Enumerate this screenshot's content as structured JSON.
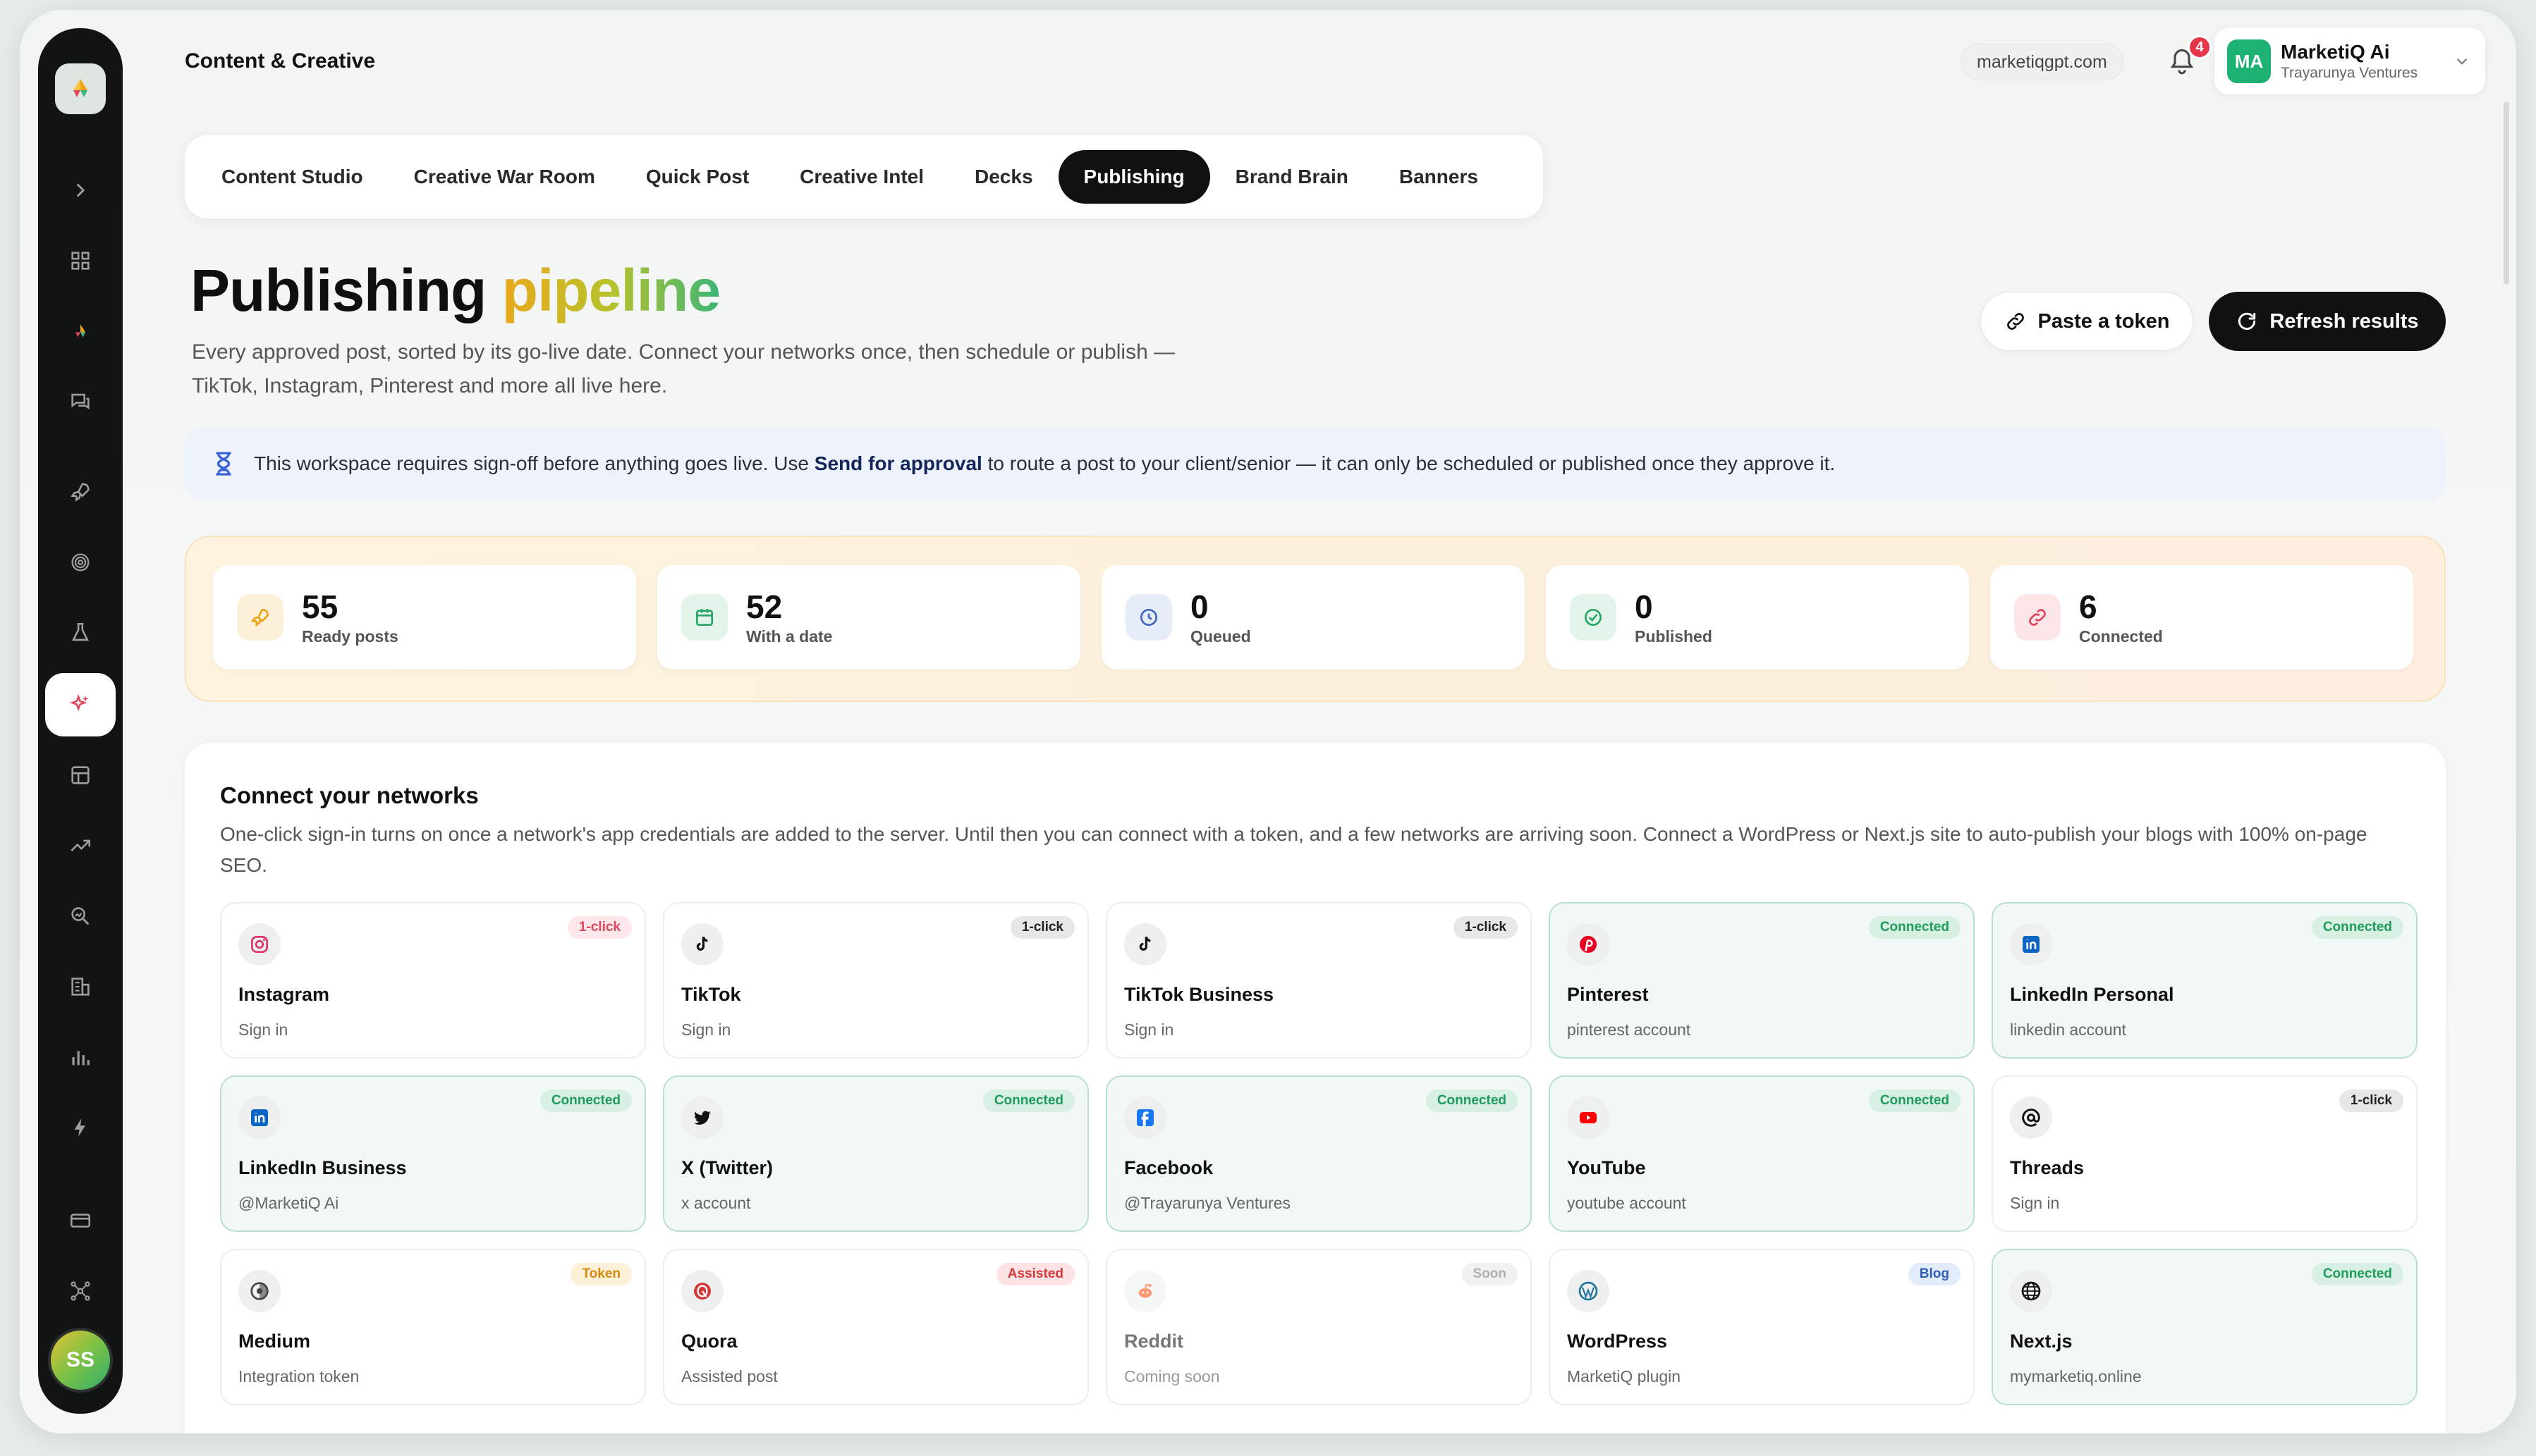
{
  "header": {
    "breadcrumb": "Content & Creative",
    "domain": "marketiqgpt.com",
    "notification_count": "4",
    "user": {
      "initials": "MA",
      "name": "MarketiQ Ai",
      "org": "Trayarunya Ventures"
    }
  },
  "sidebar": {
    "avatar_initials": "SS",
    "icons": [
      "expand-chevron-icon",
      "dashboard-grid-icon",
      "brand-logo-icon",
      "chat-icon",
      "rocket-icon",
      "fingerprint-icon",
      "flask-icon",
      "sparkles-icon",
      "layout-icon",
      "trend-icon",
      "search-chart-icon",
      "building-icon",
      "bar-chart-icon",
      "bolt-icon",
      "card-icon",
      "network-icon"
    ],
    "active": "sparkles-icon"
  },
  "tabs": [
    {
      "label": "Content Studio",
      "active": false
    },
    {
      "label": "Creative War Room",
      "active": false
    },
    {
      "label": "Quick Post",
      "active": false
    },
    {
      "label": "Creative Intel",
      "active": false
    },
    {
      "label": "Decks",
      "active": false
    },
    {
      "label": "Publishing",
      "active": true
    },
    {
      "label": "Brand Brain",
      "active": false
    },
    {
      "label": "Banners",
      "active": false
    }
  ],
  "page": {
    "title_main": "Publishing",
    "title_accent": "pipeline",
    "subtitle": "Every approved post, sorted by its go-live date. Connect your networks once, then schedule or publish — TikTok, Instagram, Pinterest and more all live here.",
    "paste_token_label": "Paste a token",
    "refresh_label": "Refresh results"
  },
  "notice": {
    "before": "This workspace requires sign-off before anything goes live. Use ",
    "bold": "Send for approval",
    "after": " to route a post to your client/senior — it can only be scheduled or published once they approve it."
  },
  "stats": [
    {
      "value": "55",
      "label": "Ready posts",
      "icon": "rocket-icon",
      "color": "#f0a318",
      "bg": "#fdf0d8"
    },
    {
      "value": "52",
      "label": "With a date",
      "icon": "calendar-icon",
      "color": "#27a765",
      "bg": "#e3f4ea"
    },
    {
      "value": "0",
      "label": "Queued",
      "icon": "clock-icon",
      "color": "#3f63c2",
      "bg": "#e6ecf8"
    },
    {
      "value": "0",
      "label": "Published",
      "icon": "check-circle-icon",
      "color": "#27a765",
      "bg": "#e3f4ea"
    },
    {
      "value": "6",
      "label": "Connected",
      "icon": "link-icon",
      "color": "#e0465c",
      "bg": "#fde6e8"
    }
  ],
  "networks": {
    "title": "Connect your networks",
    "description": "One-click sign-in turns on once a network's app credentials are added to the server. Until then you can connect with a token, and a few networks are arriving soon. Connect a WordPress or Next.js site to auto-publish your blogs with 100% on-page SEO.",
    "items": [
      {
        "name": "Instagram",
        "sub": "Sign in",
        "badge": "1-click",
        "badge_style": "b-1click-pink",
        "state": "",
        "icon": "instagram-icon",
        "color": "#e1306c"
      },
      {
        "name": "TikTok",
        "sub": "Sign in",
        "badge": "1-click",
        "badge_style": "b-1click-gray",
        "state": "",
        "icon": "tiktok-icon",
        "color": "#111111"
      },
      {
        "name": "TikTok Business",
        "sub": "Sign in",
        "badge": "1-click",
        "badge_style": "b-1click-gray",
        "state": "",
        "icon": "tiktok-icon",
        "color": "#111111"
      },
      {
        "name": "Pinterest",
        "sub": "pinterest account",
        "badge": "Connected",
        "badge_style": "b-conn",
        "state": "connected",
        "icon": "pinterest-icon",
        "color": "#e60023"
      },
      {
        "name": "LinkedIn Personal",
        "sub": "linkedin account",
        "badge": "Connected",
        "badge_style": "b-conn",
        "state": "connected",
        "icon": "linkedin-icon",
        "color": "#0a66c2"
      },
      {
        "name": "LinkedIn Business",
        "sub": "@MarketiQ Ai",
        "badge": "Connected",
        "badge_style": "b-conn",
        "state": "connected",
        "icon": "linkedin-icon",
        "color": "#0a66c2"
      },
      {
        "name": "X (Twitter)",
        "sub": "x account",
        "badge": "Connected",
        "badge_style": "b-conn",
        "state": "connected",
        "icon": "twitter-icon",
        "color": "#111111"
      },
      {
        "name": "Facebook",
        "sub": "@Trayarunya Ventures",
        "badge": "Connected",
        "badge_style": "b-conn",
        "state": "connected",
        "icon": "facebook-icon",
        "color": "#1877f2"
      },
      {
        "name": "YouTube",
        "sub": "youtube account",
        "badge": "Connected",
        "badge_style": "b-conn",
        "state": "connected",
        "icon": "youtube-icon",
        "color": "#ff0000"
      },
      {
        "name": "Threads",
        "sub": "Sign in",
        "badge": "1-click",
        "badge_style": "b-1click-gray",
        "state": "",
        "icon": "threads-icon",
        "color": "#111111"
      },
      {
        "name": "Medium",
        "sub": "Integration token",
        "badge": "Token",
        "badge_style": "b-token",
        "state": "",
        "icon": "medium-icon",
        "color": "#444444"
      },
      {
        "name": "Quora",
        "sub": "Assisted post",
        "badge": "Assisted",
        "badge_style": "b-assist",
        "state": "",
        "icon": "quora-icon",
        "color": "#d23a3a"
      },
      {
        "name": "Reddit",
        "sub": "Coming soon",
        "badge": "Soon",
        "badge_style": "b-soon",
        "state": "dim",
        "icon": "reddit-icon",
        "color": "#ff4500"
      },
      {
        "name": "WordPress",
        "sub": "MarketiQ plugin",
        "badge": "Blog",
        "badge_style": "b-blog",
        "state": "",
        "icon": "wordpress-icon",
        "color": "#21759b"
      },
      {
        "name": "Next.js",
        "sub": "mymarketiq.online",
        "badge": "Connected",
        "badge_style": "b-conn",
        "state": "connected",
        "icon": "globe-icon",
        "color": "#111111"
      }
    ]
  }
}
